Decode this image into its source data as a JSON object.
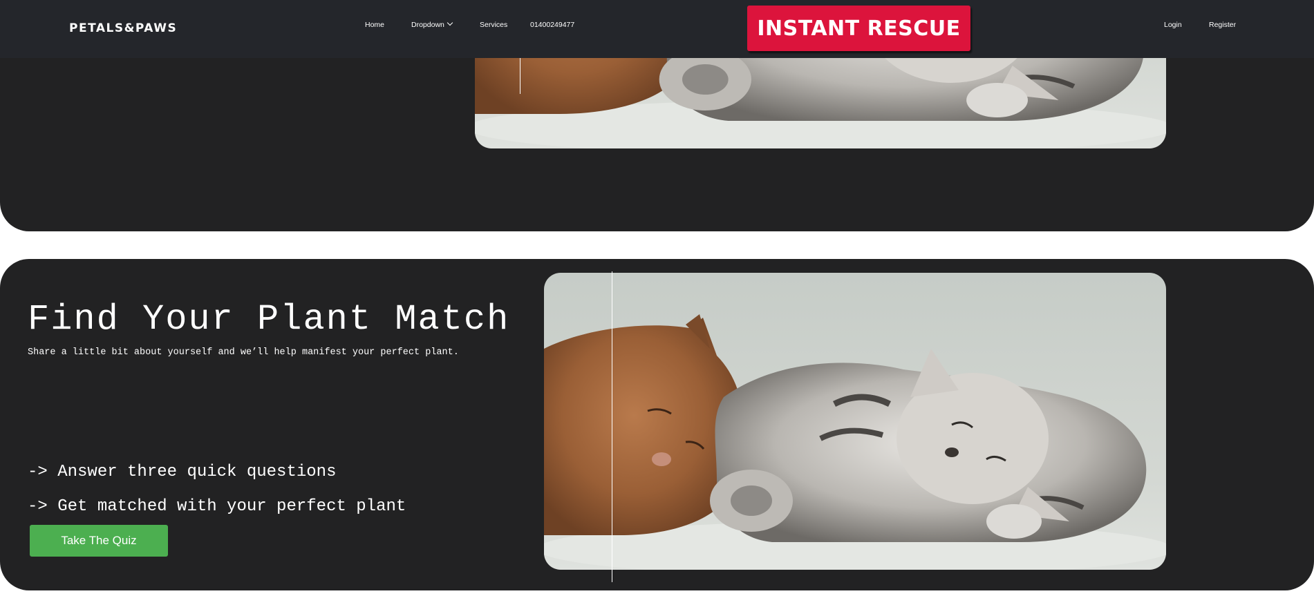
{
  "navbar": {
    "brand": "PETALS&PAWS",
    "links": {
      "home": "Home",
      "dropdown": "Dropdown",
      "services": "Services",
      "phone": "01400249477"
    },
    "rescue_label": "INSTANT RESCUE",
    "login": "Login",
    "register": "Register"
  },
  "hero": {
    "title": "Find Your Plant Match",
    "subtitle": "Share a little bit about yourself and we’ll help manifest your perfect plant.",
    "bullets": [
      "-> Answer three quick questions",
      "-> Get matched with your perfect plant"
    ],
    "quiz_button": "Take The Quiz"
  },
  "images": {
    "top_photo": "kittens-photo",
    "main_photo": "kittens-photo"
  },
  "colors": {
    "navbar_bg": "#24262b",
    "section_bg": "#222223",
    "rescue": "#dc143c",
    "quiz_button": "#4caf50"
  }
}
